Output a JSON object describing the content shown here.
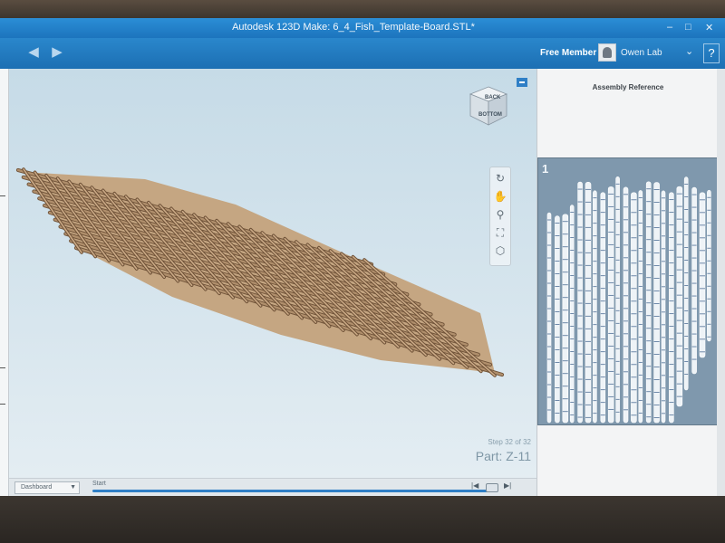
{
  "window": {
    "title": "Autodesk 123D Make: 6_4_Fish_Template-Board.STL*",
    "controls": {
      "minimize": "–",
      "maximize": "□",
      "close": "✕"
    }
  },
  "toolbar": {
    "back_icon": "back-arrow-icon",
    "forward_icon": "forward-arrow-icon",
    "back_glyph": "◀",
    "forward_glyph": "▶",
    "member_label": "Free Member",
    "username": "Owen Lab",
    "user_caret": "⌄",
    "help_label": "?"
  },
  "viewport": {
    "nav_cube": {
      "top_face": "BACK",
      "front_face": "BOTTOM"
    },
    "nav_tools": [
      {
        "name": "orbit-icon",
        "glyph": "↻"
      },
      {
        "name": "pan-icon",
        "glyph": "✋"
      },
      {
        "name": "zoom-icon",
        "glyph": "⚲"
      },
      {
        "name": "fit-view-icon",
        "glyph": "⛶"
      },
      {
        "name": "home-view-icon",
        "glyph": "⬡"
      }
    ],
    "step_text": "Step 32 of 32",
    "part_label": "Part: Z-11"
  },
  "bottom_bar": {
    "display_mode": "Dashboard",
    "display_caret": "▼",
    "start_label": "Start",
    "step_back": "|◀",
    "step_forward": "▶|",
    "progress": 1.0
  },
  "assembly": {
    "title": "Assembly Reference",
    "sheet_number": "1"
  },
  "colors": {
    "titlebar": "#1c74bd",
    "wood": "#b08f6c",
    "wood_edge": "#6f5238",
    "accent": "#2f7fc6"
  }
}
